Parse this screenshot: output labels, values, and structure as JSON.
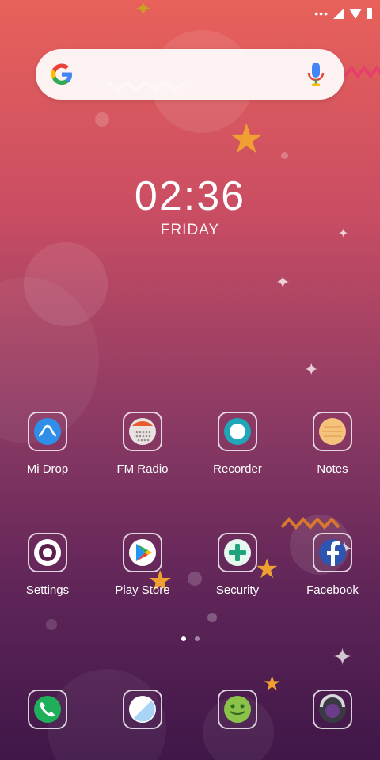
{
  "search": {
    "brand_icon": "google-g-icon",
    "mic_icon": "mic-icon"
  },
  "clock": {
    "time": "02:36",
    "day": "FRIDAY"
  },
  "apps_row1": [
    {
      "label": "Mi Drop",
      "icon": "mi-drop-icon"
    },
    {
      "label": "FM Radio",
      "icon": "fm-radio-icon"
    },
    {
      "label": "Recorder",
      "icon": "recorder-icon"
    },
    {
      "label": "Notes",
      "icon": "notes-icon"
    }
  ],
  "apps_row2": [
    {
      "label": "Settings",
      "icon": "settings-icon"
    },
    {
      "label": "Play Store",
      "icon": "play-store-icon"
    },
    {
      "label": "Security",
      "icon": "security-icon"
    },
    {
      "label": "Facebook",
      "icon": "facebook-icon"
    }
  ],
  "dock": [
    {
      "icon": "phone-icon"
    },
    {
      "icon": "messaging-icon"
    },
    {
      "icon": "android-icon"
    },
    {
      "icon": "camera-icon"
    }
  ],
  "pager": {
    "pages": 2,
    "current": 1
  },
  "colors": {
    "gradient_top": "#e8615a",
    "gradient_bottom": "#3f1748",
    "star": "#f0a030"
  }
}
